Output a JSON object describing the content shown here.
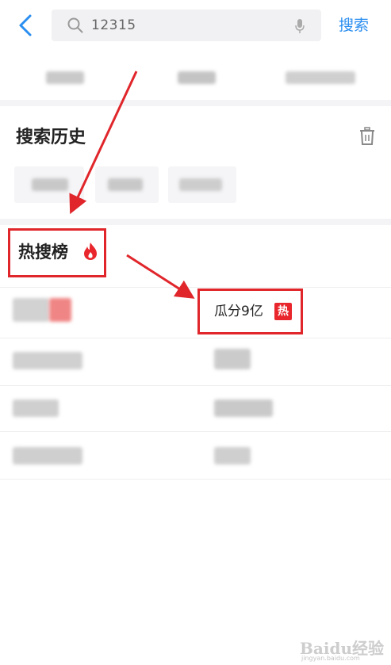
{
  "search": {
    "query": "12315",
    "button_label": "搜索"
  },
  "history": {
    "title": "搜索历史"
  },
  "hot_list": {
    "title": "热搜榜",
    "featured_item": "瓜分9亿",
    "featured_badge": "热"
  },
  "watermark": {
    "text": "Baidu经验",
    "subtext": "jingyan.baidu.com"
  },
  "colors": {
    "accent_blue": "#2a8ef0",
    "highlight_red": "#e0262b"
  }
}
